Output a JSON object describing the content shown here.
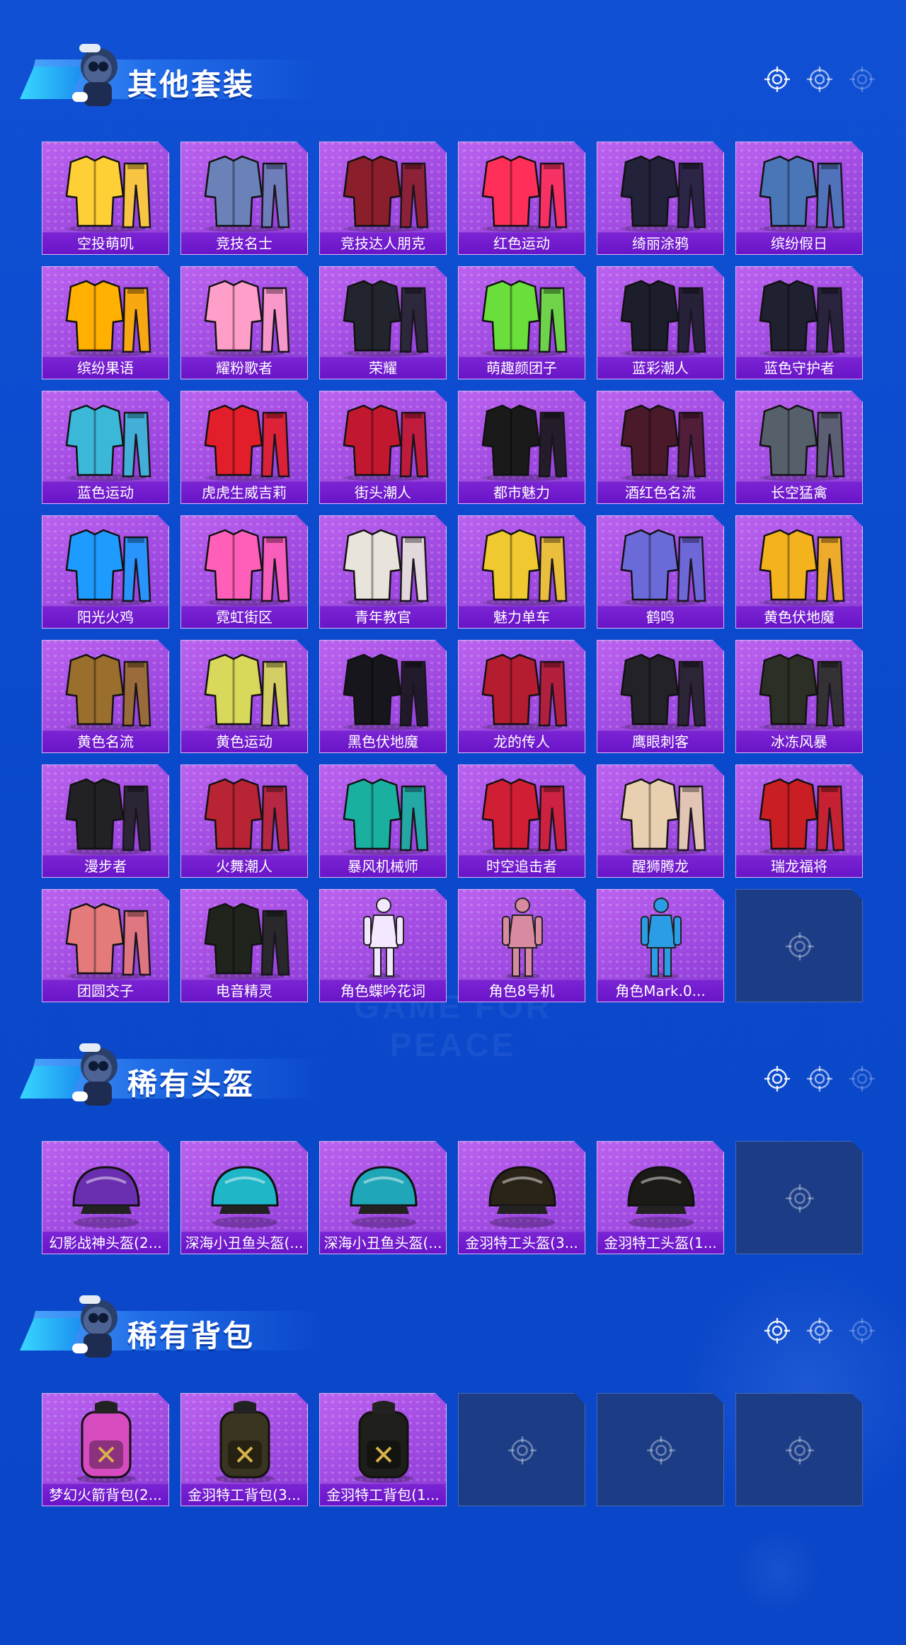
{
  "theme": {
    "card_colors": [
      "#ffd036",
      "#5a6fa8",
      "#8a1e2a",
      "#ff2f5a",
      "#22223a",
      "#4a76b8",
      "#ffb000",
      "#ff9ec8",
      "#23252e",
      "#6adf3c",
      "#1c1e2b",
      "#1f2030",
      "#3bb8d8",
      "#e11e2a",
      "#c2182f",
      "#1a1a1a",
      "#4a1a2a",
      "#56606a",
      "#1e9bff",
      "#ff5fb8",
      "#e8e4dc",
      "#f0c830",
      "#6a6ad8",
      "#f4b21c",
      "#9a6e2c",
      "#d8d85a",
      "#16161c",
      "#b41c30",
      "#222",
      "#2b2f26",
      "#222",
      "#b82434",
      "#1ab0a0",
      "#d01e34",
      "#e8cfb0",
      "#c81e24",
      "#e47a7a",
      "#1f251c",
      "#f3e8ff",
      "#d88aa0",
      "#2a9de6"
    ],
    "accent_light": "#bb63ef",
    "accent_dark": "#6a14c8",
    "empty_slot": "#1c3d86"
  },
  "watermark": "GAME FOR PEACE",
  "sections": [
    {
      "title": "其他套装",
      "items": [
        {
          "label": "空投萌叽",
          "icon": "outfit-icon",
          "color": "#ffd036"
        },
        {
          "label": "竞技名士",
          "icon": "outfit-icon",
          "color": "#6b82b8"
        },
        {
          "label": "竞技达人朋克",
          "icon": "outfit-icon",
          "color": "#8a1e2a"
        },
        {
          "label": "红色运动",
          "icon": "outfit-icon",
          "color": "#ff2f5a"
        },
        {
          "label": "绮丽涂鸦",
          "icon": "outfit-icon",
          "color": "#22223a"
        },
        {
          "label": "缤纷假日",
          "icon": "outfit-icon",
          "color": "#4a76b8"
        },
        {
          "label": "缤纷果语",
          "icon": "outfit-icon",
          "color": "#ffb000"
        },
        {
          "label": "耀粉歌者",
          "icon": "outfit-icon",
          "color": "#ff9ec8"
        },
        {
          "label": "荣耀",
          "icon": "outfit-icon",
          "color": "#23252e"
        },
        {
          "label": "萌趣颜团子",
          "icon": "outfit-icon",
          "color": "#6adf3c"
        },
        {
          "label": "蓝彩潮人",
          "icon": "outfit-icon",
          "color": "#1c1e2b"
        },
        {
          "label": "蓝色守护者",
          "icon": "outfit-icon",
          "color": "#1f2030"
        },
        {
          "label": "蓝色运动",
          "icon": "outfit-icon",
          "color": "#3bb8d8"
        },
        {
          "label": "虎虎生威吉莉",
          "icon": "outfit-icon",
          "color": "#e11e2a"
        },
        {
          "label": "街头潮人",
          "icon": "outfit-icon",
          "color": "#c2182f"
        },
        {
          "label": "都市魅力",
          "icon": "outfit-icon",
          "color": "#1a1a1a"
        },
        {
          "label": "酒红色名流",
          "icon": "outfit-icon",
          "color": "#4a1a2a"
        },
        {
          "label": "长空猛禽",
          "icon": "outfit-icon",
          "color": "#56606a"
        },
        {
          "label": "阳光火鸡",
          "icon": "outfit-icon",
          "color": "#1e9bff"
        },
        {
          "label": "霓虹街区",
          "icon": "outfit-icon",
          "color": "#ff5fb8"
        },
        {
          "label": "青年教官",
          "icon": "outfit-icon",
          "color": "#e8e4dc"
        },
        {
          "label": "魅力单车",
          "icon": "outfit-icon",
          "color": "#f0c830"
        },
        {
          "label": "鹤鸣",
          "icon": "outfit-icon",
          "color": "#6a6ad8"
        },
        {
          "label": "黄色伏地魔",
          "icon": "outfit-icon",
          "color": "#f4b21c"
        },
        {
          "label": "黄色名流",
          "icon": "outfit-icon",
          "color": "#9a6e2c"
        },
        {
          "label": "黄色运动",
          "icon": "outfit-icon",
          "color": "#d8d85a"
        },
        {
          "label": "黑色伏地魔",
          "icon": "outfit-icon",
          "color": "#16161c"
        },
        {
          "label": "龙的传人",
          "icon": "outfit-icon",
          "color": "#b41c30"
        },
        {
          "label": "鹰眼刺客",
          "icon": "outfit-icon",
          "color": "#222228"
        },
        {
          "label": "冰冻风暴",
          "icon": "outfit-icon",
          "color": "#2b2f26"
        },
        {
          "label": "漫步者",
          "icon": "outfit-icon",
          "color": "#222226"
        },
        {
          "label": "火舞潮人",
          "icon": "outfit-icon",
          "color": "#b82434"
        },
        {
          "label": "暴风机械师",
          "icon": "outfit-icon",
          "color": "#1ab0a0"
        },
        {
          "label": "时空追击者",
          "icon": "outfit-icon",
          "color": "#d01e34"
        },
        {
          "label": "醒狮腾龙",
          "icon": "outfit-icon",
          "color": "#e8cfb0"
        },
        {
          "label": "瑞龙福将",
          "icon": "outfit-icon",
          "color": "#c81e24"
        },
        {
          "label": "团圆交子",
          "icon": "outfit-icon",
          "color": "#e47a7a"
        },
        {
          "label": "电音精灵",
          "icon": "outfit-icon",
          "color": "#1f251c"
        },
        {
          "label": "角色蝶吟花词",
          "icon": "figure-icon",
          "color": "#f3e8ff"
        },
        {
          "label": "角色8号机",
          "icon": "figure-icon",
          "color": "#d88aa0"
        },
        {
          "label": "角色Mark.0...",
          "icon": "figure-icon",
          "color": "#2a9de6"
        }
      ],
      "empty_slots": 1
    },
    {
      "title": "稀有头盔",
      "items": [
        {
          "label": "幻影战神头盔(2...",
          "icon": "helmet-icon",
          "color": "#6a2fb0"
        },
        {
          "label": "深海小丑鱼头盔(...",
          "icon": "helmet-icon",
          "color": "#1fb6c8"
        },
        {
          "label": "深海小丑鱼头盔(...",
          "icon": "helmet-icon",
          "color": "#1fa6b8"
        },
        {
          "label": "金羽特工头盔(3...",
          "icon": "helmet-icon",
          "color": "#2a2418"
        },
        {
          "label": "金羽特工头盔(1...",
          "icon": "helmet-icon",
          "color": "#1c1a16"
        }
      ],
      "empty_slots": 1
    },
    {
      "title": "稀有背包",
      "items": [
        {
          "label": "梦幻火箭背包(2...",
          "icon": "backpack-icon",
          "color": "#d64cc0"
        },
        {
          "label": "金羽特工背包(3...",
          "icon": "backpack-icon",
          "color": "#3a3520"
        },
        {
          "label": "金羽特工背包(1...",
          "icon": "backpack-icon",
          "color": "#1e1e1a"
        }
      ],
      "empty_slots": 3
    }
  ]
}
